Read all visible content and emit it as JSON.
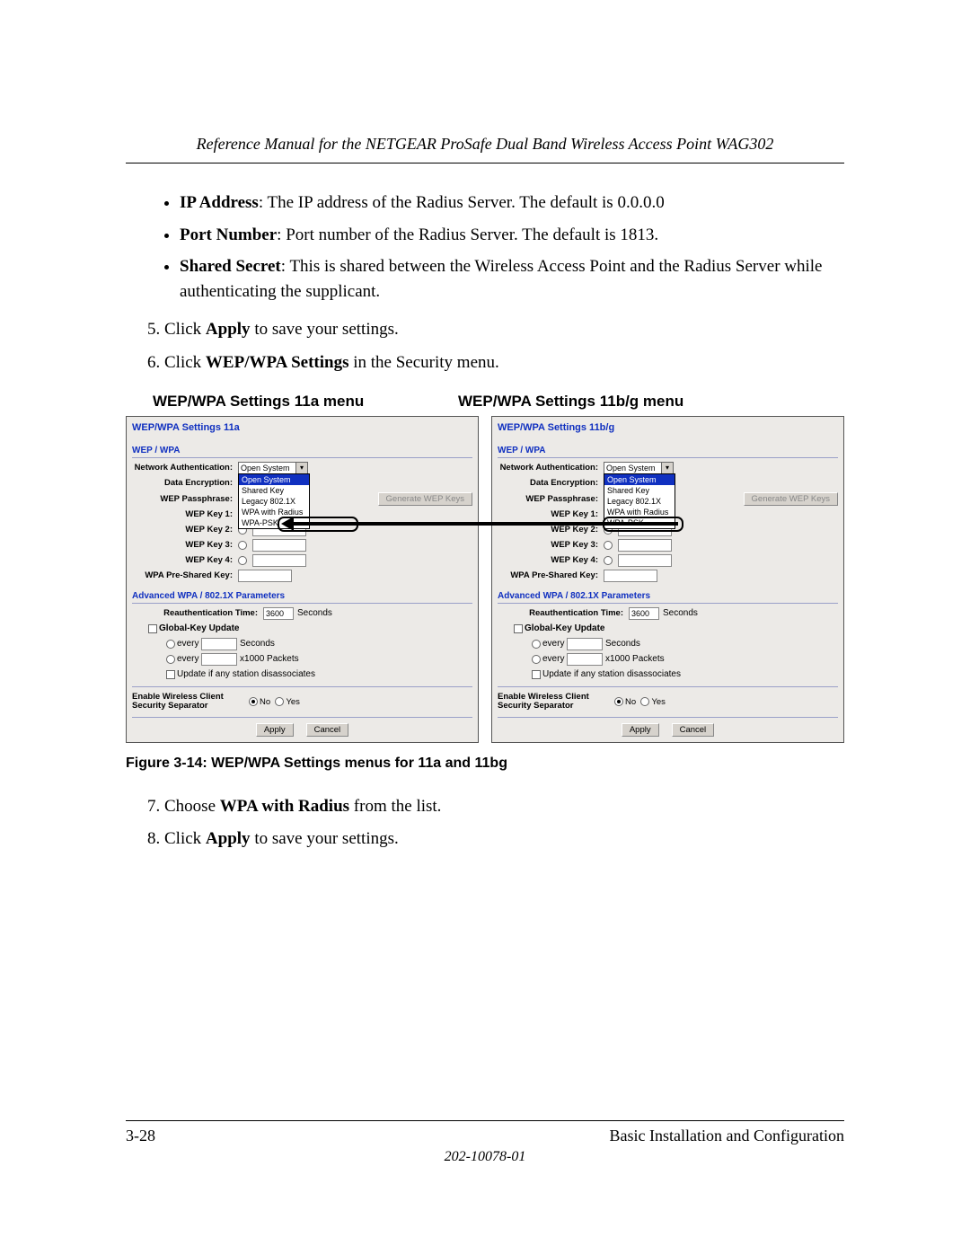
{
  "header": {
    "running_title": "Reference Manual for the NETGEAR ProSafe Dual Band Wireless Access Point WAG302"
  },
  "bullets": {
    "ip_label": "IP Address",
    "ip_text": ": The IP address of the Radius Server. The default is 0.0.0.0",
    "port_label": "Port Number",
    "port_text": ": Port number of the Radius Server. The default is 1813.",
    "secret_label": "Shared Secret",
    "secret_text": ": This is shared between the Wireless Access Point and the Radius Server while authenticating the supplicant."
  },
  "steps": {
    "s5_num": "5.",
    "s5_a": "Click ",
    "s5_b": "Apply",
    "s5_c": " to save your settings.",
    "s6_num": "6.",
    "s6_a": "Click ",
    "s6_b": "WEP/WPA Settings",
    "s6_c": " in the Security menu.",
    "s7_num": "7.",
    "s7_a": "Choose ",
    "s7_b": "WPA with Radius",
    "s7_c": " from the list.",
    "s8_num": "8.",
    "s8_a": "Click ",
    "s8_b": "Apply",
    "s8_c": " to save your settings."
  },
  "menu_titles": {
    "left": "WEP/WPA Settings 11a menu",
    "right": "WEP/WPA Settings 11b/g menu"
  },
  "panel_labels": {
    "wepwpa": "WEP / WPA",
    "net_auth": "Network Authentication:",
    "data_enc": "Data Encryption:",
    "wep_pass": "WEP Passphrase:",
    "wep_key1": "WEP Key 1:",
    "wep_key2": "WEP Key 2:",
    "wep_key3": "WEP Key 3:",
    "wep_key4": "WEP Key 4:",
    "wpa_psk": "WPA Pre-Shared Key:",
    "adv_hdr": "Advanced WPA / 802.1X Parameters",
    "reauth": "Reauthentication Time:",
    "seconds": "Seconds",
    "gku": "Global-Key Update",
    "every": "every",
    "packets": "x1000 Packets",
    "update_any": "Update if any station disassociates",
    "sep_label": "Enable Wireless Client Security Separator",
    "no": "No",
    "yes": "Yes",
    "apply": "Apply",
    "cancel": "Cancel",
    "gen_keys": "Generate WEP Keys"
  },
  "panel_left": {
    "title": "WEP/WPA Settings 11a",
    "auth_selected": "Open System",
    "options": [
      "Open System",
      "Shared Key",
      "Legacy 802.1X",
      "WPA with Radius",
      "WPA-PSK"
    ],
    "hl_index": 3,
    "reauth_val": "3600"
  },
  "panel_right": {
    "title": "WEP/WPA Settings 11b/g",
    "auth_selected": "Open System",
    "options": [
      "Open System",
      "Shared Key",
      "Legacy 802.1X",
      "WPA with Radius",
      "WPA-PSK"
    ],
    "hl_index": 3,
    "reauth_val": "3600"
  },
  "figure_caption": "Figure 3-14:  WEP/WPA Settings menus for 11a and 11bg",
  "footer": {
    "page_num": "3-28",
    "section": "Basic Installation and Configuration",
    "docid": "202-10078-01"
  }
}
